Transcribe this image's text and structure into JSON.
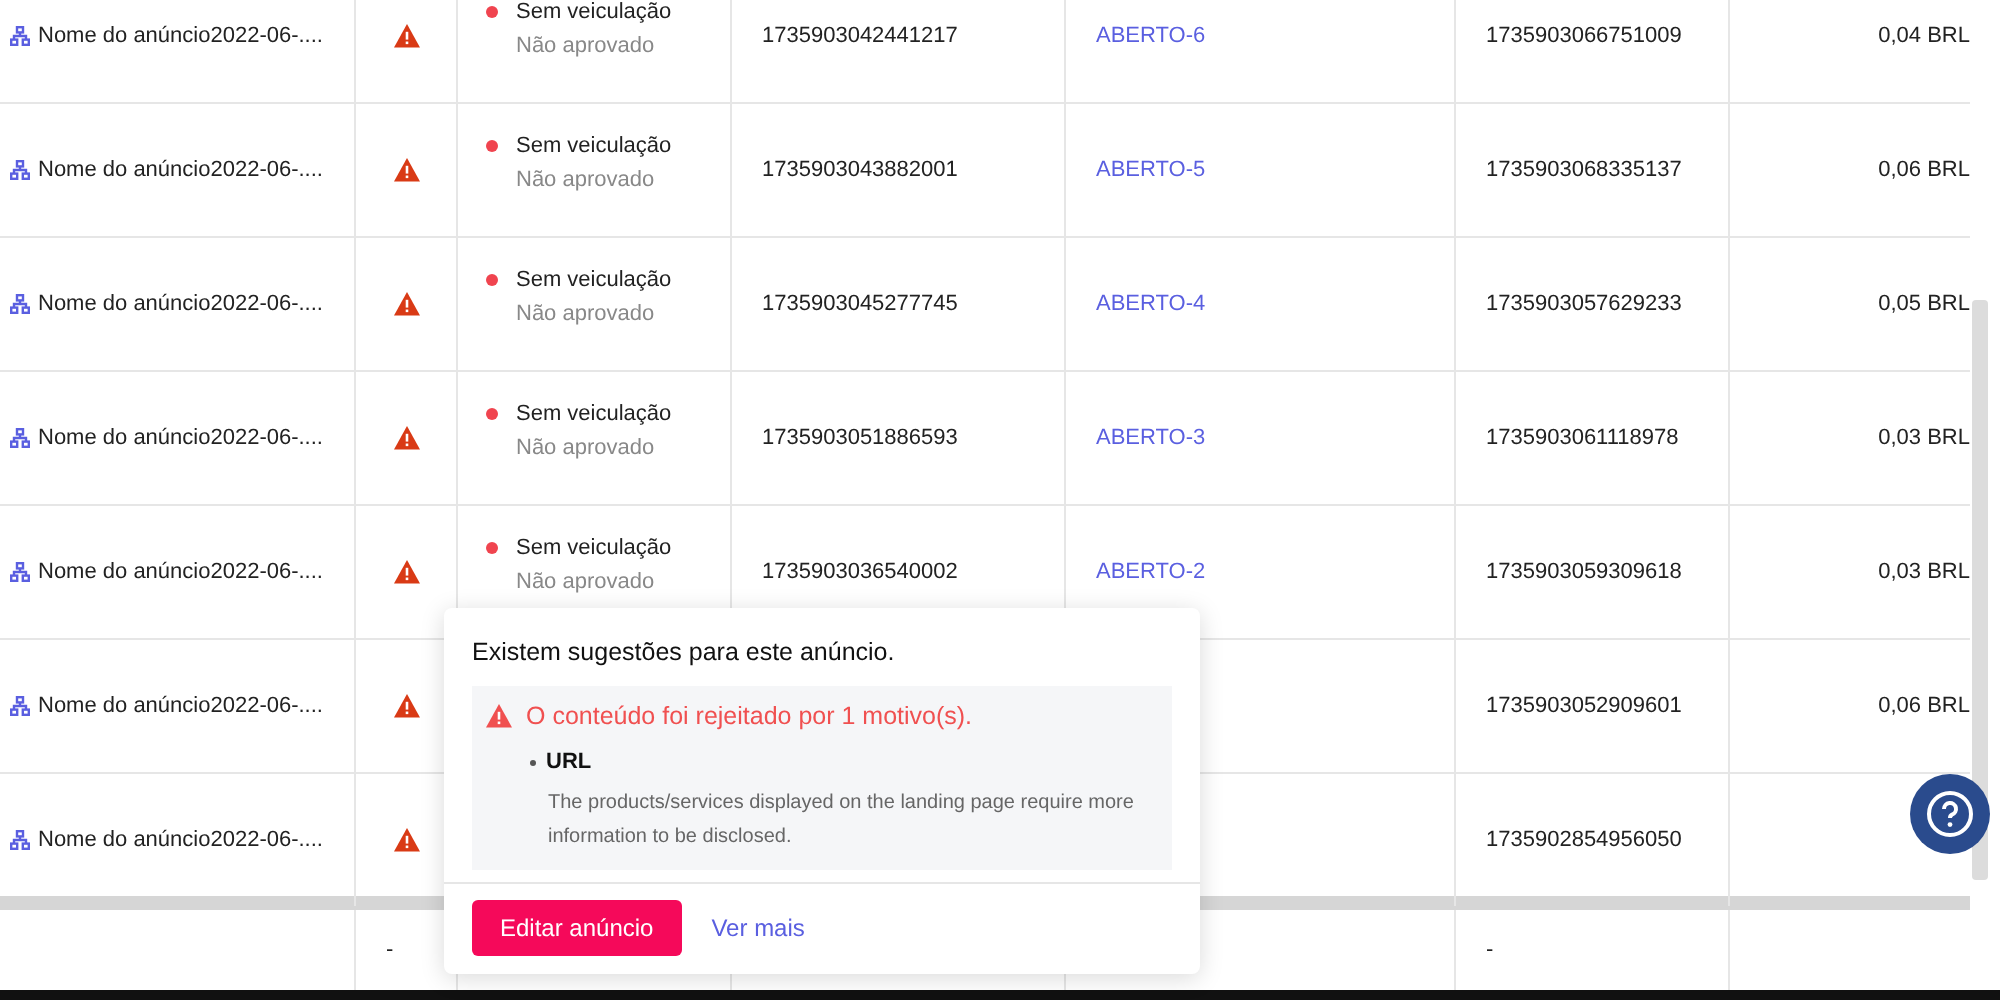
{
  "rows": [
    {
      "name": "Nome do anúncio2022-06-....",
      "status": "Sem veiculação",
      "review": "Não aprovado",
      "ad_id": "1735903042441217",
      "group": "ABERTO-6",
      "group_id": "1735903066751009",
      "cost": "0,04 BRL"
    },
    {
      "name": "Nome do anúncio2022-06-....",
      "status": "Sem veiculação",
      "review": "Não aprovado",
      "ad_id": "1735903043882001",
      "group": "ABERTO-5",
      "group_id": "1735903068335137",
      "cost": "0,06 BRL"
    },
    {
      "name": "Nome do anúncio2022-06-....",
      "status": "Sem veiculação",
      "review": "Não aprovado",
      "ad_id": "1735903045277745",
      "group": "ABERTO-4",
      "group_id": "1735903057629233",
      "cost": "0,05 BRL"
    },
    {
      "name": "Nome do anúncio2022-06-....",
      "status": "Sem veiculação",
      "review": "Não aprovado",
      "ad_id": "1735903051886593",
      "group": "ABERTO-3",
      "group_id": "1735903061118978",
      "cost": "0,03 BRL"
    },
    {
      "name": "Nome do anúncio2022-06-....",
      "status": "Sem veiculação",
      "review": "Não aprovado",
      "ad_id": "1735903036540002",
      "group": "ABERTO-2",
      "group_id": "1735903059309618",
      "cost": "0,03 BRL"
    },
    {
      "name": "Nome do anúncio2022-06-....",
      "group_id": "1735903052909601",
      "cost": "0,06 BRL"
    },
    {
      "name": "Nome do anúncio2022-06-....",
      "group_id": "1735902854956050"
    }
  ],
  "totals": {
    "column_2": "-",
    "column_6": "-"
  },
  "popover": {
    "title": "Existem sugestões para este anúncio.",
    "alert": "O conteúdo foi rejeitado por 1 motivo(s).",
    "reason": "URL",
    "detail": "The products/services displayed on the landing page require more information to be disclosed.",
    "primary_button": "Editar anúncio",
    "link": "Ver mais"
  }
}
